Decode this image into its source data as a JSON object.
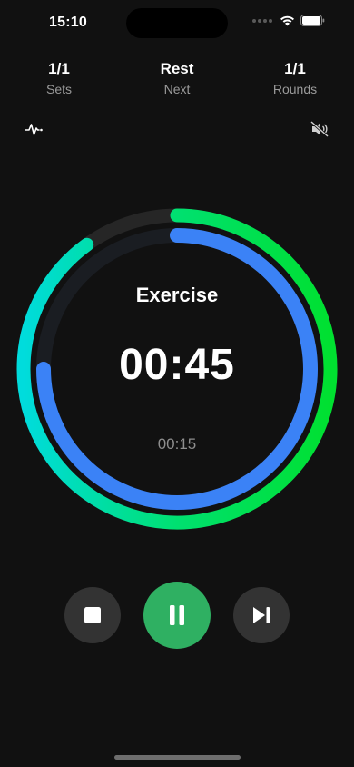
{
  "status_bar": {
    "time": "15:10",
    "icons": [
      "signal-dots-icon",
      "wifi-icon",
      "battery-icon"
    ]
  },
  "stats": {
    "sets": {
      "value": "1/1",
      "label": "Sets"
    },
    "next": {
      "value": "Rest",
      "label": "Next"
    },
    "rounds": {
      "value": "1/1",
      "label": "Rounds"
    }
  },
  "toolbar": {
    "left_icon": "heartbeat-icon",
    "right_icon": "speaker-muted-icon"
  },
  "timer": {
    "phase": "Exercise",
    "time": "00:45",
    "sub_time": "00:15",
    "outer_progress": 0.9,
    "inner_progress": 0.75
  },
  "colors": {
    "background": "#111111",
    "outer_track": "#262626",
    "inner_track": "#1a1d22",
    "outer_gradient": [
      "#00dcdc",
      "#00e070",
      "#00e030"
    ],
    "inner_ring": "#3b82f6",
    "pause_button": "#2fb062",
    "secondary_button": "#333333"
  },
  "controls": {
    "stop_icon": "stop-icon",
    "pause_icon": "pause-icon",
    "next_icon": "skip-next-icon"
  }
}
